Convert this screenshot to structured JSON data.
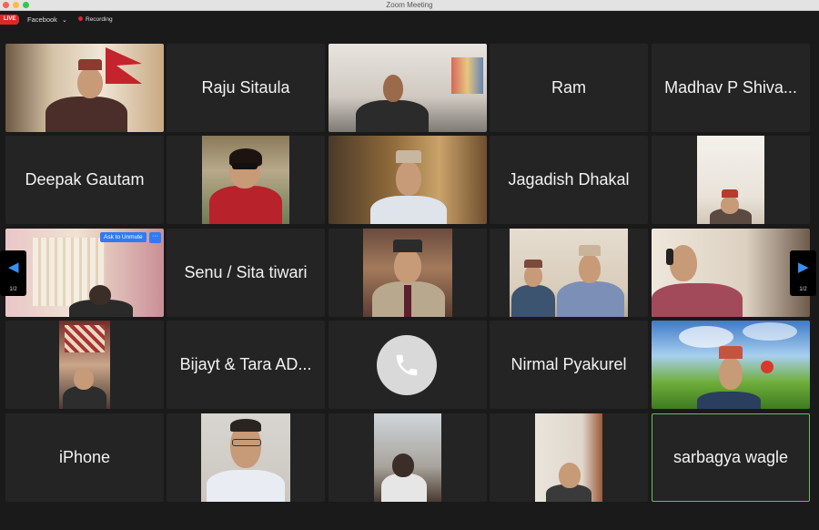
{
  "window": {
    "title": "Zoom Meeting"
  },
  "topbar": {
    "live_badge": "LIVE",
    "stream_target": "Facebook",
    "recording_label": "Recording"
  },
  "pagination": {
    "prev_page": "1/2",
    "next_page": "1/2"
  },
  "tile_controls": {
    "ask_to_unmute": "Ask to Unmute",
    "more": "···"
  },
  "participants": {
    "raju": "Raju Sitaula",
    "ram": "Ram",
    "madhav": "Madhav P Shiva...",
    "deepak": "Deepak Gautam",
    "jagadish": "Jagadish Dhakal",
    "senu": "Senu / Sita tiwari",
    "bijayt": "Bijayt & Tara AD...",
    "nirmal": "Nirmal Pyakurel",
    "iphone": "iPhone",
    "sarbagya": "sarbagya wagle"
  },
  "colors": {
    "active_speaker_border": "#5fc15f",
    "live": "#e0252d",
    "accent_blue": "#2d7cf5"
  }
}
